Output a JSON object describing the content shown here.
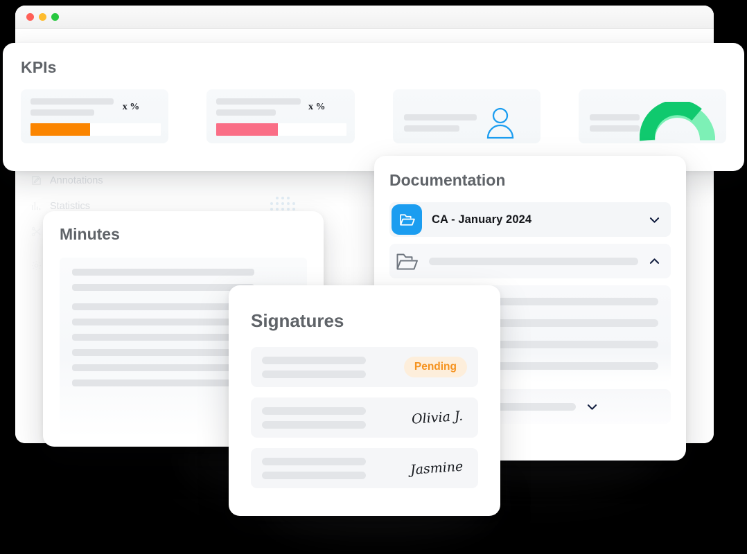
{
  "browser": {
    "traffic_lights": [
      {
        "name": "close",
        "color": "#ff5f57"
      },
      {
        "name": "minimize",
        "color": "#febc2e"
      },
      {
        "name": "maximize",
        "color": "#28c840"
      }
    ]
  },
  "faded_sidebar": {
    "items": [
      {
        "label": "Annotations",
        "icon": "annotation-icon"
      },
      {
        "label": "Statistics",
        "icon": "bar-chart-icon"
      },
      {
        "label": "",
        "icon": "scissors-icon"
      },
      {
        "label": "",
        "icon": "settings-icon"
      }
    ]
  },
  "kpis": {
    "title": "KPIs",
    "cards": [
      {
        "name": "kpi-progress-orange",
        "percent_label": "x %",
        "fill_color": "#fb8500",
        "fill_percent": 46,
        "track_color": "#ffffff"
      },
      {
        "name": "kpi-progress-pink",
        "percent_label": "x %",
        "fill_color": "#fa6e86",
        "fill_percent": 47,
        "track_color": "#ffffff"
      },
      {
        "name": "kpi-user",
        "icon": "person-icon",
        "icon_color": "#1b9df0"
      },
      {
        "name": "kpi-gauge",
        "icon": "gauge-icon",
        "gauge_percent": 72,
        "gauge_color": "#10c96e",
        "gauge_track_color": "#7df0b6"
      }
    ]
  },
  "minutes": {
    "title": "Minutes",
    "line_widths": [
      "82%",
      "82%",
      "100%",
      "100%",
      "100%",
      "100%",
      "100%",
      "100%"
    ]
  },
  "documentation": {
    "title": "Documentation",
    "rows": [
      {
        "name": "documentation-row-ca-january-2024",
        "label": "CA - January 2024",
        "icon": "folder-open-blue-icon",
        "chevron": "chevron-down-icon"
      },
      {
        "name": "documentation-row-skeleton",
        "label": "",
        "icon": "folder-open-outline-icon",
        "chevron": "chevron-up-icon"
      }
    ],
    "skeleton_widths": [
      "100%",
      "100%",
      "100%",
      "100%"
    ],
    "footer_row": {
      "name": "documentation-row-footer",
      "chevron": "chevron-down-icon"
    }
  },
  "signatures": {
    "title": "Signatures",
    "rows": [
      {
        "name": "signature-row-pending",
        "status": "Pending",
        "signature": ""
      },
      {
        "name": "signature-row-olivia",
        "status": "",
        "signature": "Olivia J."
      },
      {
        "name": "signature-row-jasmine",
        "status": "",
        "signature": "Jasmine"
      }
    ]
  },
  "colors": {
    "accent_blue": "#1b9df0",
    "accent_orange": "#fb8500",
    "accent_pink": "#fa6e86",
    "accent_green": "#10c96e",
    "pending_text": "#f5921e",
    "pending_bg": "#fdeedb"
  }
}
